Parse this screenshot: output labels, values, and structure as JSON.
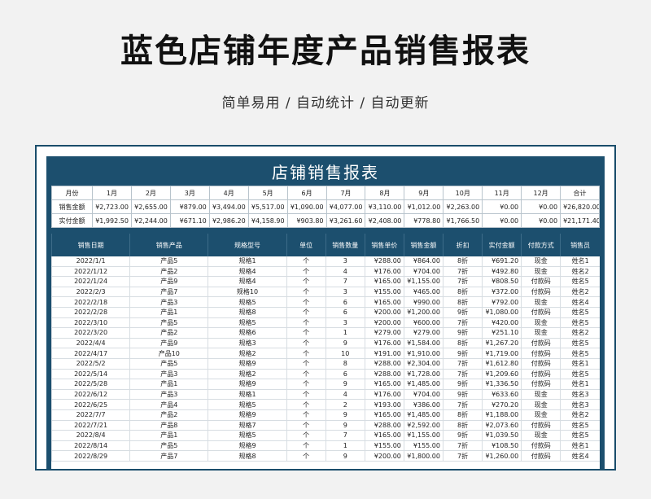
{
  "header": {
    "title": "蓝色店铺年度产品销售报表",
    "subtitle": "简单易用 / 自动统计 / 自动更新"
  },
  "sheet": {
    "title": "店铺销售报表",
    "summary": {
      "headers": [
        "月份",
        "1月",
        "2月",
        "3月",
        "4月",
        "5月",
        "6月",
        "7月",
        "8月",
        "9月",
        "10月",
        "11月",
        "12月",
        "合计"
      ],
      "rows": [
        {
          "label": "销售金额",
          "values": [
            "¥2,723.00",
            "¥2,655.00",
            "¥879.00",
            "¥3,494.00",
            "¥5,517.00",
            "¥1,090.00",
            "¥4,077.00",
            "¥3,110.00",
            "¥1,012.00",
            "¥2,263.00",
            "¥0.00",
            "¥0.00",
            "¥26,820.00"
          ]
        },
        {
          "label": "实付金额",
          "values": [
            "¥1,992.50",
            "¥2,244.00",
            "¥671.10",
            "¥2,986.20",
            "¥4,158.90",
            "¥903.80",
            "¥3,261.60",
            "¥2,408.00",
            "¥778.80",
            "¥1,766.50",
            "¥0.00",
            "¥0.00",
            "¥21,171.40"
          ]
        }
      ]
    },
    "detail": {
      "headers": [
        "销售日期",
        "销售产品",
        "规格型号",
        "单位",
        "销售数量",
        "销售单价",
        "销售金额",
        "折扣",
        "实付金额",
        "付款方式",
        "销售员"
      ],
      "rows": [
        [
          "2022/1/1",
          "产品5",
          "规格1",
          "个",
          "3",
          "¥288.00",
          "¥864.00",
          "8折",
          "¥691.20",
          "现金",
          "姓名1"
        ],
        [
          "2022/1/12",
          "产品2",
          "规格4",
          "个",
          "4",
          "¥176.00",
          "¥704.00",
          "7折",
          "¥492.80",
          "现金",
          "姓名2"
        ],
        [
          "2022/1/24",
          "产品9",
          "规格4",
          "个",
          "7",
          "¥165.00",
          "¥1,155.00",
          "7折",
          "¥808.50",
          "付款码",
          "姓名5"
        ],
        [
          "2022/2/3",
          "产品7",
          "规格10",
          "个",
          "3",
          "¥155.00",
          "¥465.00",
          "8折",
          "¥372.00",
          "付款码",
          "姓名2"
        ],
        [
          "2022/2/18",
          "产品3",
          "规格5",
          "个",
          "6",
          "¥165.00",
          "¥990.00",
          "8折",
          "¥792.00",
          "现金",
          "姓名4"
        ],
        [
          "2022/2/28",
          "产品1",
          "规格8",
          "个",
          "6",
          "¥200.00",
          "¥1,200.00",
          "9折",
          "¥1,080.00",
          "付款码",
          "姓名5"
        ],
        [
          "2022/3/10",
          "产品5",
          "规格5",
          "个",
          "3",
          "¥200.00",
          "¥600.00",
          "7折",
          "¥420.00",
          "现金",
          "姓名5"
        ],
        [
          "2022/3/20",
          "产品2",
          "规格6",
          "个",
          "1",
          "¥279.00",
          "¥279.00",
          "9折",
          "¥251.10",
          "现金",
          "姓名2"
        ],
        [
          "2022/4/4",
          "产品9",
          "规格3",
          "个",
          "9",
          "¥176.00",
          "¥1,584.00",
          "8折",
          "¥1,267.20",
          "付款码",
          "姓名5"
        ],
        [
          "2022/4/17",
          "产品10",
          "规格2",
          "个",
          "10",
          "¥191.00",
          "¥1,910.00",
          "9折",
          "¥1,719.00",
          "付款码",
          "姓名5"
        ],
        [
          "2022/5/2",
          "产品5",
          "规格9",
          "个",
          "8",
          "¥288.00",
          "¥2,304.00",
          "7折",
          "¥1,612.80",
          "付款码",
          "姓名1"
        ],
        [
          "2022/5/14",
          "产品3",
          "规格2",
          "个",
          "6",
          "¥288.00",
          "¥1,728.00",
          "7折",
          "¥1,209.60",
          "付款码",
          "姓名5"
        ],
        [
          "2022/5/28",
          "产品1",
          "规格9",
          "个",
          "9",
          "¥165.00",
          "¥1,485.00",
          "9折",
          "¥1,336.50",
          "付款码",
          "姓名1"
        ],
        [
          "2022/6/12",
          "产品3",
          "规格1",
          "个",
          "4",
          "¥176.00",
          "¥704.00",
          "9折",
          "¥633.60",
          "现金",
          "姓名3"
        ],
        [
          "2022/6/25",
          "产品4",
          "规格5",
          "个",
          "2",
          "¥193.00",
          "¥386.00",
          "7折",
          "¥270.20",
          "现金",
          "姓名3"
        ],
        [
          "2022/7/7",
          "产品2",
          "规格9",
          "个",
          "9",
          "¥165.00",
          "¥1,485.00",
          "8折",
          "¥1,188.00",
          "现金",
          "姓名2"
        ],
        [
          "2022/7/21",
          "产品8",
          "规格7",
          "个",
          "9",
          "¥288.00",
          "¥2,592.00",
          "8折",
          "¥2,073.60",
          "付款码",
          "姓名5"
        ],
        [
          "2022/8/4",
          "产品1",
          "规格5",
          "个",
          "7",
          "¥165.00",
          "¥1,155.00",
          "9折",
          "¥1,039.50",
          "现金",
          "姓名5"
        ],
        [
          "2022/8/14",
          "产品5",
          "规格9",
          "个",
          "1",
          "¥155.00",
          "¥155.00",
          "7折",
          "¥108.50",
          "付款码",
          "姓名1"
        ],
        [
          "2022/8/29",
          "产品7",
          "规格8",
          "个",
          "9",
          "¥200.00",
          "¥1,800.00",
          "7折",
          "¥1,260.00",
          "付款码",
          "姓名4"
        ]
      ]
    }
  },
  "colors": {
    "accent": "#1c4f6e",
    "background": "#f2f2f2"
  }
}
